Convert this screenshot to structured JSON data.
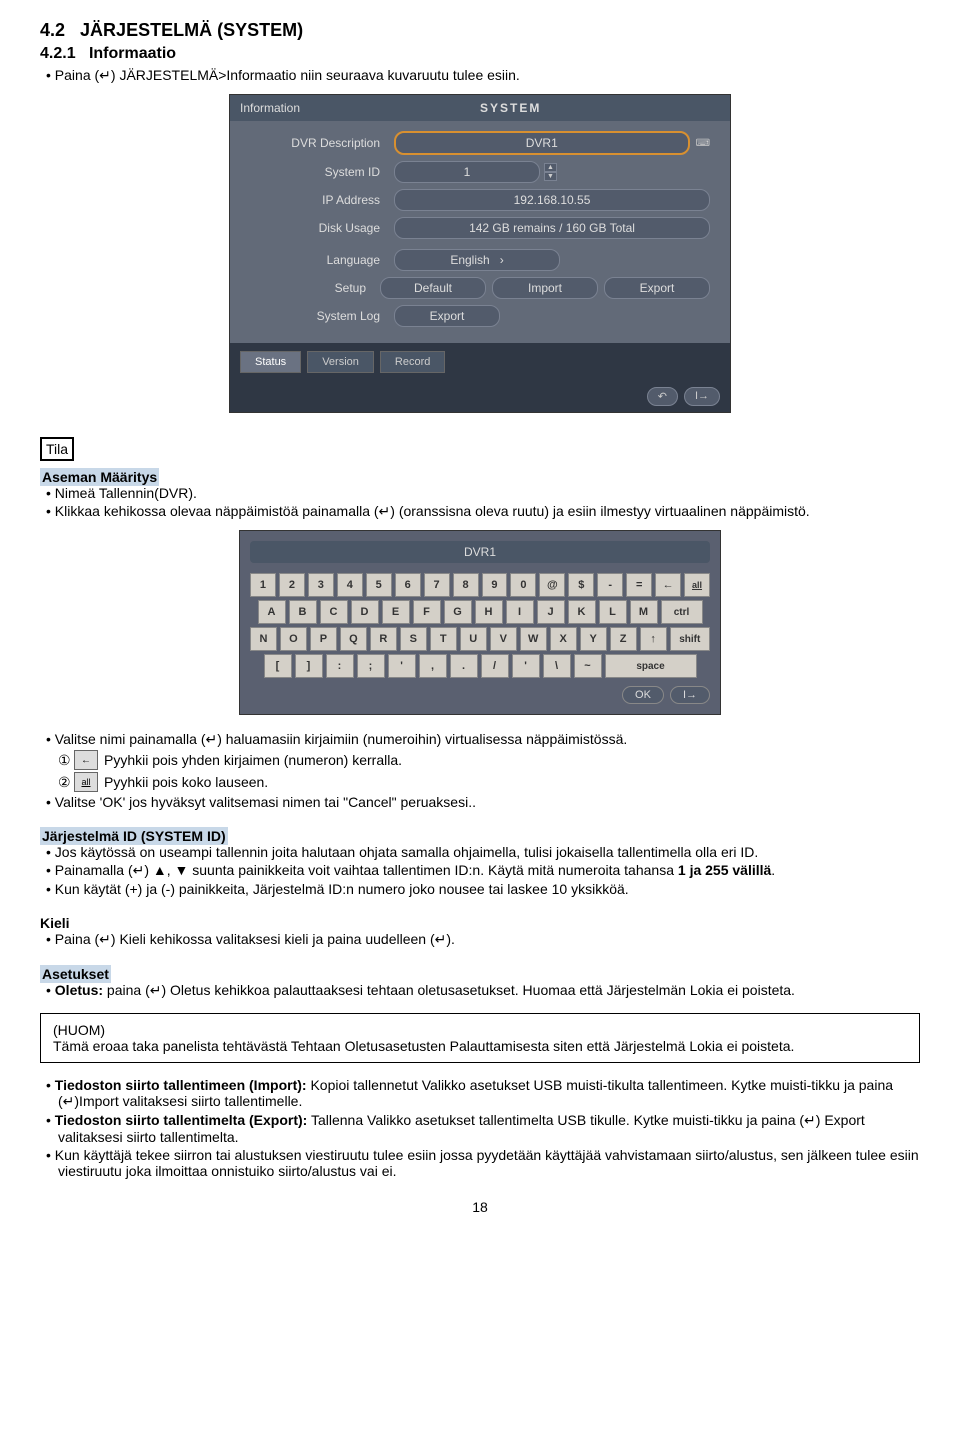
{
  "doc": {
    "h_num": "4.2",
    "h_title": "JÄRJESTELMÄ (SYSTEM)",
    "sub_num": "4.2.1",
    "sub_title": "Informaatio",
    "intro_bullet": "Paina (↵) JÄRJESTELMÄ>Informaatio niin seuraava kuvaruutu tulee esiin.",
    "tila": "Tila",
    "aseman_maaritys": "Aseman Määritys",
    "nimea": "Nimeä Tallennin(DVR).",
    "klikkaa": "Klikkaa kehikossa olevaa näppäimistöä painamalla (↵) (oranssisna oleva ruutu) ja esiin ilmestyy virtuaalinen näppäimistö.",
    "valitse_nimi": "Valitse nimi painamalla (↵) haluamasiin kirjaimiin (numeroihin) virtualisessa näppäimistössä.",
    "pyyhkii1": "Pyyhkii pois yhden kirjaimen (numeron) kerralla.",
    "pyyhkii2": "Pyyhkii pois koko lauseen.",
    "valitse_ok": "Valitse 'OK' jos hyväksyt valitsemasi nimen tai \"Cancel\" peruaksesi..",
    "jarj_id_h": "Järjestelmä ID (SYSTEM ID)",
    "jarj_id_1": "Jos käytössä on useampi tallennin joita halutaan ohjata samalla ohjaimella, tulisi jokaisella tallentimella olla eri ID.",
    "jarj_id_2a": "Painamalla (↵) ▲, ▼ suunta painikkeita voit vaihtaa tallentimen ID:n. Käytä mitä numeroita tahansa ",
    "jarj_id_2b": "1 ja 255 välillä",
    "jarj_id_3": "Kun käytät (+) ja (-) painikkeita, Järjestelmä ID:n numero joko nousee tai laskee 10 yksikköä.",
    "kieli_h": "Kieli",
    "kieli_1": "Paina (↵) Kieli kehikossa valitaksesi kieli ja paina uudelleen (↵).",
    "asetukset_h": "Asetukset",
    "oletus_label": "Oletus:",
    "oletus_text": " paina (↵) Oletus kehikkoa palauttaaksesi tehtaan oletusasetukset. Huomaa että Järjestelmän Lokia ei poisteta.",
    "huom_label": "(HUOM)",
    "huom_text": "Tämä eroaa taka panelista tehtävästä Tehtaan Oletusasetusten Palauttamisesta siten että Järjestelmä Lokia ei poisteta.",
    "import_label": "Tiedoston siirto tallentimeen (Import):",
    "import_text": " Kopioi tallennetut Valikko asetukset USB muisti-tikulta tallentimeen. Kytke muisti-tikku ja paina (↵)Import valitaksesi siirto tallentimelle.",
    "export_label": "Tiedoston siirto tallentimelta (Export):",
    "export_text": " Tallenna Valikko asetukset tallentimelta USB tikulle. Kytke muisti-tikku ja paina (↵) Export valitaksesi siirto tallentimelta.",
    "last_bullet": "Kun käyttäjä tekee siirron tai alustuksen viestiruutu tulee esiin jossa pyydetään käyttäjää vahvistamaan siirto/alustus, sen jälkeen tulee esiin viestiruutu joka ilmoittaa onnistuiko siirto/alustus vai ei.",
    "page": "18"
  },
  "panel": {
    "title_left": "Information",
    "title_right": "SYSTEM",
    "desc_lbl": "DVR Description",
    "desc_val": "DVR1",
    "sysid_lbl": "System ID",
    "sysid_val": "1",
    "ip_lbl": "IP Address",
    "ip_val": "192.168.10.55",
    "disk_lbl": "Disk Usage",
    "disk_val": "142 GB remains / 160 GB Total",
    "lang_lbl": "Language",
    "lang_val": "English",
    "setup_lbl": "Setup",
    "setup_default": "Default",
    "setup_import": "Import",
    "setup_export": "Export",
    "syslog_lbl": "System Log",
    "syslog_val": "Export",
    "tab_status": "Status",
    "tab_version": "Version",
    "tab_record": "Record",
    "btn_back": "↶",
    "btn_exit": "I→"
  },
  "kb": {
    "title": "DVR1",
    "row1": [
      "1",
      "2",
      "3",
      "4",
      "5",
      "6",
      "7",
      "8",
      "9",
      "0",
      "@",
      "$",
      "-",
      "="
    ],
    "row1_end1": "←",
    "row1_end2": "all",
    "row2": [
      "A",
      "B",
      "C",
      "D",
      "E",
      "F",
      "G",
      "H",
      "I",
      "J",
      "K",
      "L",
      "M"
    ],
    "row2_end": "ctrl",
    "row3": [
      "N",
      "O",
      "P",
      "Q",
      "R",
      "S",
      "T",
      "U",
      "V",
      "W",
      "X",
      "Y",
      "Z",
      "↑"
    ],
    "row3_end": "shift",
    "row4": [
      "[",
      "]",
      ":",
      ";",
      "'",
      ",",
      ".",
      "/",
      "'",
      "\\",
      "~"
    ],
    "row4_end": "space",
    "ok": "OK",
    "exit": "I→"
  },
  "icons": {
    "back_arrow": "←",
    "all": "all"
  }
}
